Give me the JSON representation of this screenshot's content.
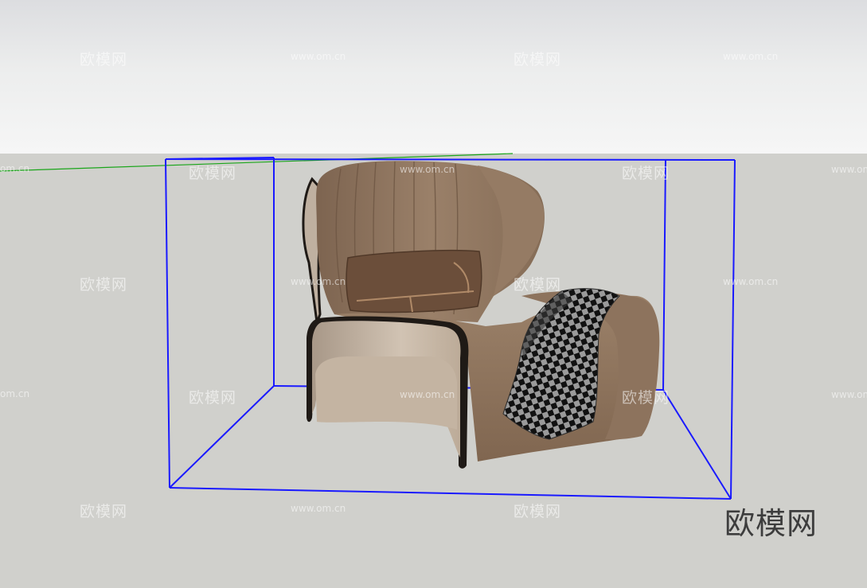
{
  "viewport": {
    "sky_label": "sky",
    "ground_label": "ground"
  },
  "watermarks": {
    "brand": "欧模网",
    "url": "www.om.cn",
    "url_fragment": "om.cn"
  },
  "logo_text": "欧模网",
  "colors": {
    "bounding_box": "#1a1aff",
    "axis_green": "#1aa51a",
    "leather": "#8b725b",
    "leather_light": "#a08670",
    "piping": "#1f1a16",
    "base_panel": "#c7b8a6",
    "pillow": "#6b4e3a"
  }
}
